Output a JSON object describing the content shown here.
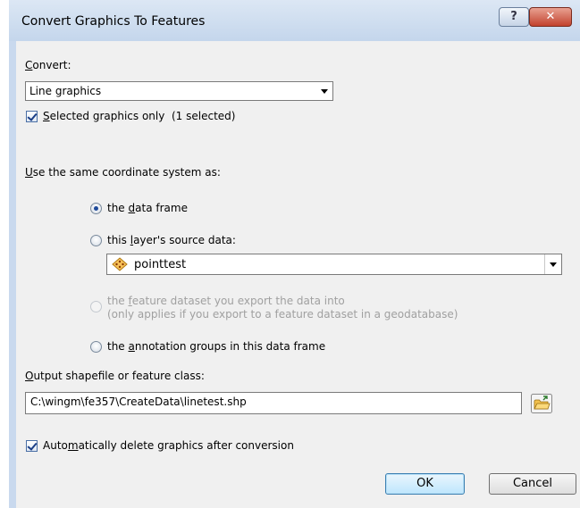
{
  "window": {
    "title": "Convert Graphics To Features",
    "help_label": "?",
    "close_label": "✕"
  },
  "convert": {
    "label": "Convert:",
    "selected_value": "Line graphics",
    "selected_only_label": "Selected graphics only",
    "selected_count": "(1 selected)",
    "selected_only_checked": true
  },
  "coordinate": {
    "label": "Use the same coordinate system as:",
    "options": [
      {
        "label": "the data frame",
        "checked": true,
        "enabled": true
      },
      {
        "label": "this layer's source data:",
        "checked": false,
        "enabled": true
      },
      {
        "label_line1": "the feature dataset you export the data into",
        "label_line2": "(only applies if you export to a feature dataset in a geodatabase)",
        "checked": false,
        "enabled": false
      },
      {
        "label": "the annotation groups in this data frame",
        "checked": false,
        "enabled": true
      }
    ],
    "layer_value": "pointtest",
    "layer_icon": "point-layer-icon"
  },
  "output": {
    "label": "Output shapefile or feature class:",
    "value": "C:\\wingm\\fe357\\CreateData\\linetest.shp",
    "browse_icon": "open-folder-icon"
  },
  "auto_delete": {
    "label": "Automatically delete graphics after conversion",
    "checked": true
  },
  "buttons": {
    "ok": "OK",
    "cancel": "Cancel"
  }
}
